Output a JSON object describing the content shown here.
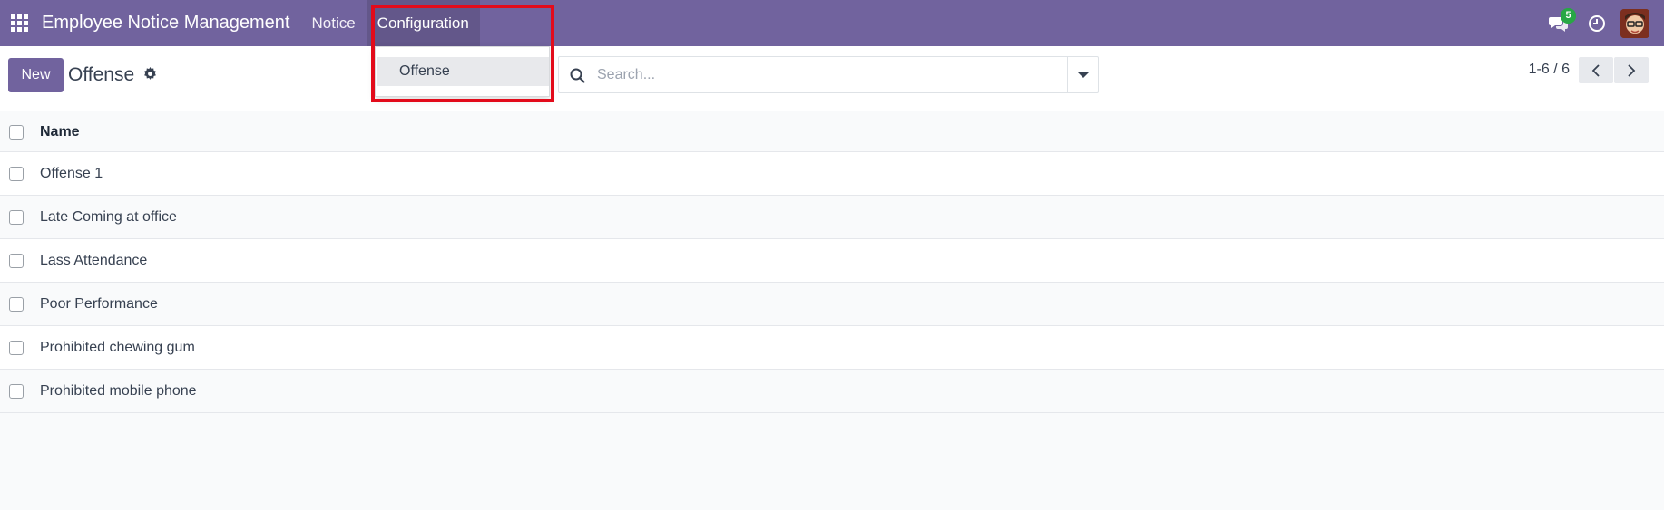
{
  "navbar": {
    "app_title": "Employee Notice Management",
    "menu": [
      {
        "label": "Notice"
      },
      {
        "label": "Configuration"
      }
    ],
    "chat_badge": "5"
  },
  "dropdown": {
    "items": [
      {
        "label": "Offense"
      }
    ]
  },
  "control": {
    "new_label": "New",
    "breadcrumb": "Offense",
    "search_placeholder": "Search...",
    "pager": "1-6 / 6"
  },
  "list": {
    "header": "Name",
    "rows": [
      {
        "name": "Offense 1"
      },
      {
        "name": "Late Coming at office"
      },
      {
        "name": "Lass Attendance"
      },
      {
        "name": "Poor Performance"
      },
      {
        "name": "Prohibited chewing gum"
      },
      {
        "name": "Prohibited mobile phone"
      }
    ]
  },
  "colors": {
    "brand": "#71639e",
    "highlight": "#e30b1b",
    "badge": "#28a745"
  }
}
